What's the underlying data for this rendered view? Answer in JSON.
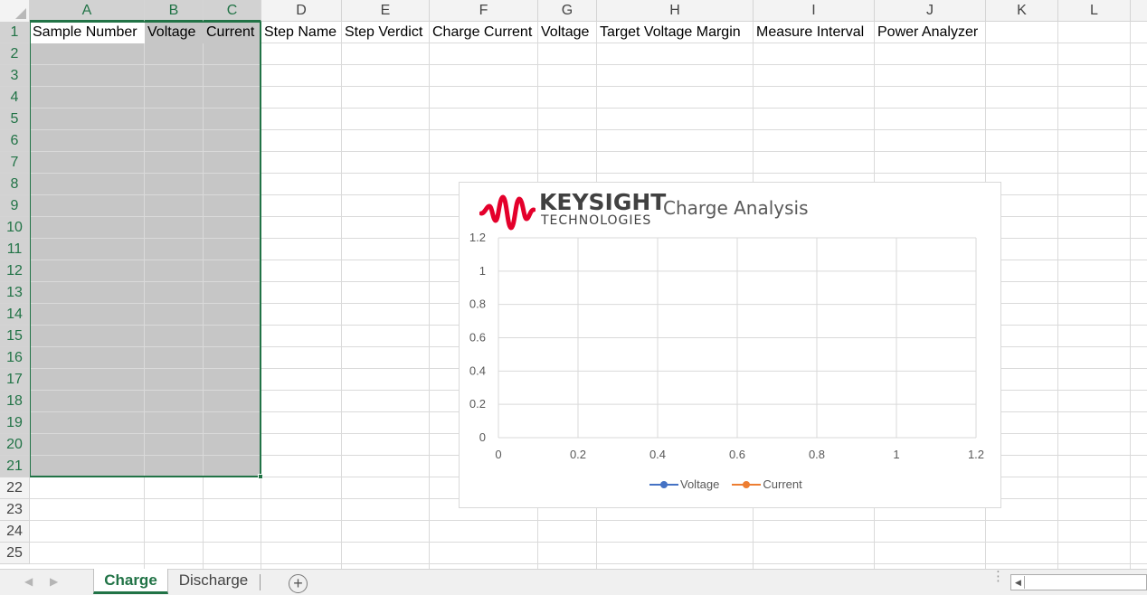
{
  "columns": [
    "A",
    "B",
    "C",
    "D",
    "E",
    "F",
    "G",
    "H",
    "I",
    "J",
    "K",
    "L"
  ],
  "rows": [
    "1",
    "2",
    "3",
    "4",
    "5",
    "6",
    "7",
    "8",
    "9",
    "10",
    "11",
    "12",
    "13",
    "14",
    "15",
    "16",
    "17",
    "18",
    "19",
    "20",
    "21",
    "22",
    "23",
    "24",
    "25"
  ],
  "header_cells": [
    "Sample Number",
    "Voltage",
    "Current",
    "Step Name",
    "Step Verdict",
    "Charge Current",
    "Voltage",
    "Target Voltage Margin",
    "Measure Interval",
    "Power Analyzer"
  ],
  "chart": {
    "logo_word": "KEYSIGHT",
    "logo_sub": "TECHNOLOGIES",
    "title": "Charge Analysis"
  },
  "chart_data": {
    "type": "line",
    "title": "Charge Analysis",
    "x": [],
    "series": [
      {
        "name": "Voltage",
        "values": [],
        "color": "#4472c4"
      },
      {
        "name": "Current",
        "values": [],
        "color": "#ed7d31"
      }
    ],
    "x_ticks": [
      "0",
      "0.2",
      "0.4",
      "0.6",
      "0.8",
      "1",
      "1.2"
    ],
    "y_ticks": [
      "0",
      "0.2",
      "0.4",
      "0.6",
      "0.8",
      "1",
      "1.2"
    ],
    "xlim": [
      0,
      1.2
    ],
    "ylim": [
      0,
      1.2
    ],
    "grid": true,
    "legend": "bottom"
  },
  "sheets": {
    "tabs": [
      "Charge",
      "Discharge"
    ],
    "active": "Charge"
  },
  "accent_color": "#217346",
  "icons": {
    "nav_prev": "triangle-left",
    "nav_next": "triangle-right",
    "add_sheet": "plus-circle",
    "scroll_left": "triangle-left"
  }
}
